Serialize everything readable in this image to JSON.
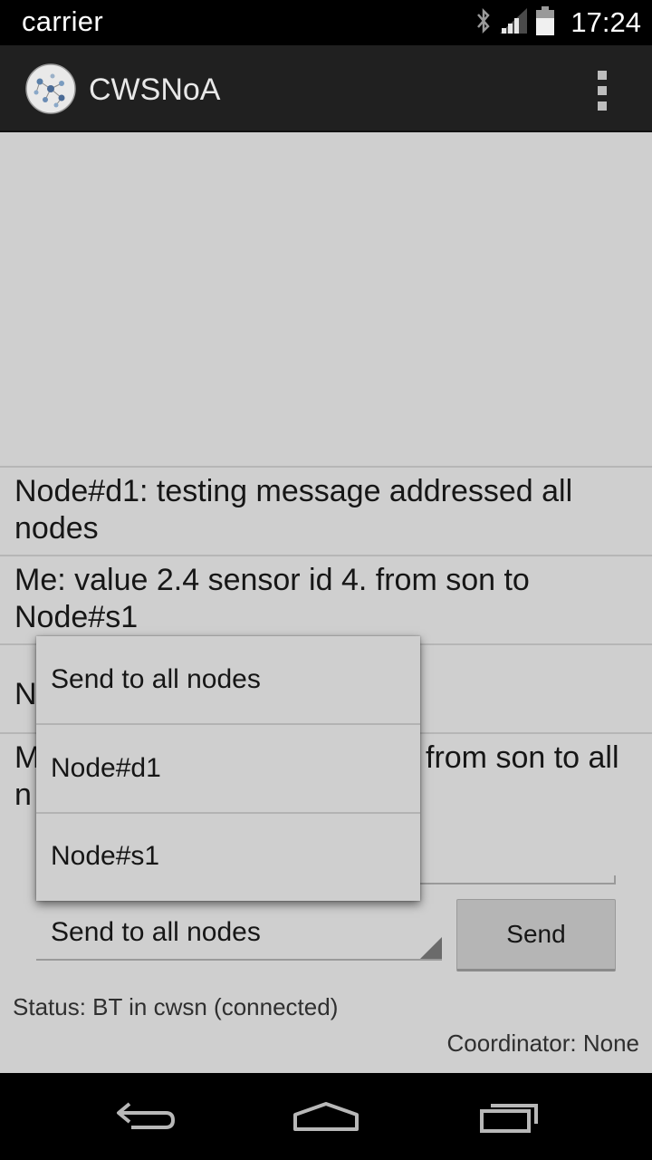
{
  "status_bar": {
    "carrier": "carrier",
    "time": "17:24",
    "icons": [
      "bluetooth-icon",
      "signal-icon",
      "battery-icon"
    ]
  },
  "action_bar": {
    "title": "CWSNoA",
    "app_icon": "network-graph-icon",
    "overflow_icon": "overflow-menu-icon"
  },
  "messages": [
    {
      "text": "Node#d1: testing message addressed all nodes"
    },
    {
      "text": "Me: value 2.4 sensor id 4. from son to Node#s1"
    },
    {
      "text": "N"
    },
    {
      "text_left": "M",
      "text_left2": "n",
      "text_right": "from son to all"
    }
  ],
  "dropdown": {
    "options": [
      "Send to all nodes",
      "Node#d1",
      "Node#s1"
    ]
  },
  "spinner": {
    "selected": "Send to all nodes"
  },
  "send_button": {
    "label": "Send"
  },
  "status": {
    "connection": "Status: BT in cwsn (connected)",
    "coordinator": "Coordinator: None"
  },
  "nav_bar": {
    "icons": [
      "back-icon",
      "home-icon",
      "recent-apps-icon"
    ]
  },
  "colors": {
    "status_bar_bg": "#000000",
    "action_bar_bg": "#202020",
    "content_bg": "#cfcfcf",
    "button_bg": "#b5b5b5"
  }
}
